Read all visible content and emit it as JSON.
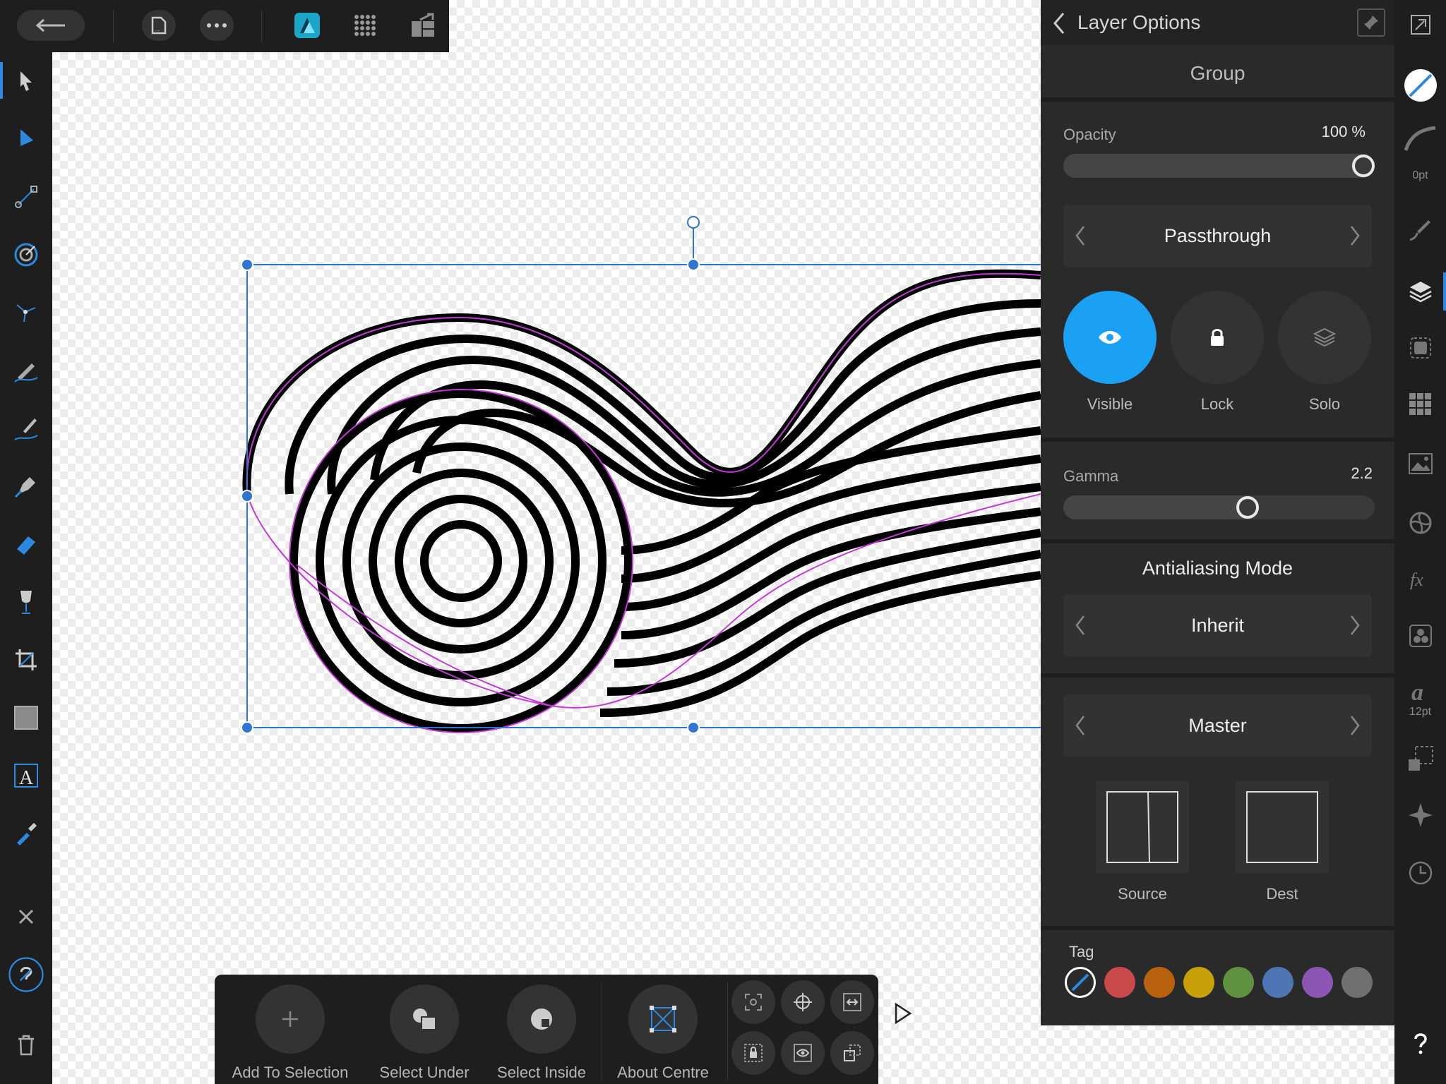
{
  "topbar": {
    "buttons": [
      "back-arrow-icon",
      "document-icon",
      "more-icon",
      "designer-persona-icon",
      "pixel-persona-icon",
      "export-persona-icon"
    ]
  },
  "panel": {
    "header_title": "Layer Options",
    "layer_type": "Group",
    "opacity_label": "Opacity",
    "opacity_value": "100 %",
    "opacity_fraction": 1.0,
    "blend_mode": "Passthrough",
    "visibility": [
      {
        "label": "Visible",
        "icon": "eye-icon",
        "active": true
      },
      {
        "label": "Lock",
        "icon": "lock-icon",
        "active": false
      },
      {
        "label": "Solo",
        "icon": "layers-icon",
        "active": false
      }
    ],
    "gamma_label": "Gamma",
    "gamma_value": "2.2",
    "gamma_fraction": 0.6,
    "antialiasing_title": "Antialiasing Mode",
    "antialiasing_value": "Inherit",
    "blend_range": "Master",
    "source_label": "Source",
    "dest_label": "Dest",
    "tag_label": "Tag",
    "tag_colors": [
      "#c84a4a",
      "#b8620f",
      "#c8a00a",
      "#5f9140",
      "#4f75b4",
      "#8c56b4",
      "#707070"
    ]
  },
  "rightstrip": {
    "stroke_width": "0pt",
    "font_size": "12pt"
  },
  "context_bar": {
    "add_to_selection": "Add To Selection",
    "select_under": "Select Under",
    "select_inside": "Select Inside",
    "about_centre": "About Centre"
  },
  "colors": {
    "accent": "#1aa1f3",
    "selection": "#2f74d0",
    "path_highlight": "#c23ad6"
  }
}
